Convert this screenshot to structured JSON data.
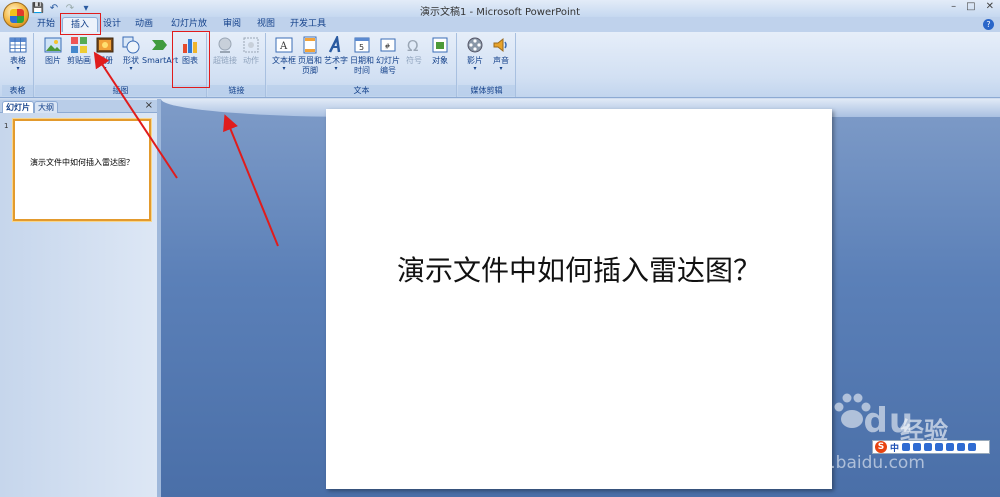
{
  "window": {
    "title": "演示文稿1 - Microsoft PowerPoint"
  },
  "tabs": [
    {
      "label": "开始"
    },
    {
      "label": "插入"
    },
    {
      "label": "设计"
    },
    {
      "label": "动画"
    },
    {
      "label": "幻灯片放映"
    },
    {
      "label": "审阅"
    },
    {
      "label": "视图"
    },
    {
      "label": "开发工具"
    }
  ],
  "ribbon": {
    "groups": {
      "tables": "表格",
      "illustrations": "插图",
      "links": "链接",
      "text": "文本",
      "media": "媒体剪辑"
    },
    "buttons": {
      "table": "表格",
      "picture": "图片",
      "clipart": "剪贴画",
      "album": "相册",
      "shapes": "形状",
      "smartart": "SmartArt",
      "chart": "图表",
      "hyperlink": "超链接",
      "action": "动作",
      "textbox": "文本框",
      "header1": "页眉和",
      "header2": "页脚",
      "wordart": "艺术字",
      "datetime1": "日期和",
      "datetime2": "时间",
      "slidenum1": "幻灯片",
      "slidenum2": "编号",
      "symbol": "符号",
      "object": "对象",
      "movie": "影片",
      "sound": "声音"
    }
  },
  "pane": {
    "tab_slides": "幻灯片",
    "tab_outline": "大纲",
    "close": "×",
    "slide_number": "1",
    "thumb_text": "演示文件中如何插入雷达图？"
  },
  "slide": {
    "title": "演示文件中如何插入雷达图？"
  },
  "watermark": {
    "brand": "Bai",
    "brand2": "du",
    "jingyan": "经验",
    "url": "jingyan.baidu.com"
  },
  "ime": {
    "s": "S",
    "label": "中"
  },
  "colors": {
    "annotation": "#e01c1c",
    "slide_bg": "#ffffff",
    "edit_bg": "#5b80b8"
  }
}
